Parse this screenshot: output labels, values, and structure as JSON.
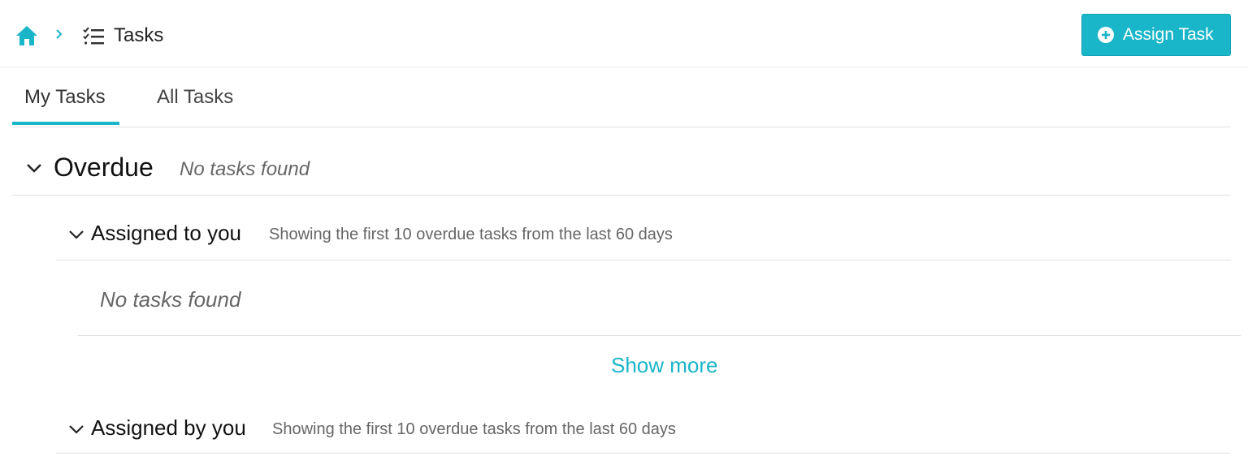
{
  "breadcrumb": {
    "home_icon": "home-icon",
    "separator_icon": "chevron-right-icon",
    "tasks_icon": "task-list-icon",
    "title": "Tasks"
  },
  "actions": {
    "assign_task_label": "Assign Task",
    "assign_task_icon": "plus-circle-icon"
  },
  "tabs": [
    {
      "label": "My Tasks",
      "active": true
    },
    {
      "label": "All Tasks",
      "active": false
    }
  ],
  "sections": {
    "overdue": {
      "title": "Overdue",
      "empty_text": "No tasks found",
      "subsections": [
        {
          "title": "Assigned to you",
          "note": "Showing the first 10 overdue tasks from the last 60 days",
          "empty_text": "No tasks found",
          "show_more_label": "Show more"
        },
        {
          "title": "Assigned by you",
          "note": "Showing the first 10 overdue tasks from the last 60 days"
        }
      ]
    }
  },
  "colors": {
    "accent": "#19b5c9",
    "divider": "#e1e1e1",
    "muted_text": "#666666"
  }
}
